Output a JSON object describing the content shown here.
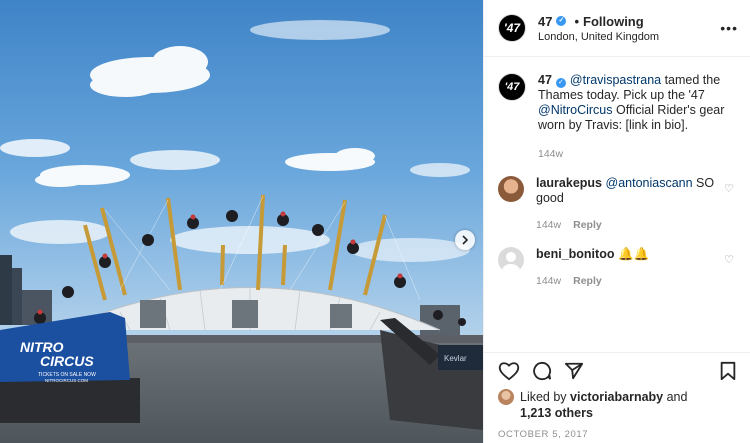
{
  "post_header": {
    "account": "47",
    "separator": "•",
    "following": "Following",
    "location": "London, United Kingdom",
    "logo_text": "'47",
    "more": "•••"
  },
  "media_caption": {
    "banner_brand_line1": "NITRO",
    "banner_brand_line2": "CIRCUS",
    "banner_tickets": "TICKETS ON SALE NOW",
    "banner_url": "NITROCIRCUS.COM",
    "boat_label": "Kevlar"
  },
  "caption": {
    "username": "47",
    "mention1": "@travispastrana",
    "text1": " tamed the Thames today. Pick up the '47 ",
    "mention2": "@NitroCircus",
    "text2": " Official Rider's gear worn by Travis: [link in bio].",
    "time": "144w"
  },
  "comments": [
    {
      "username": "laurakepus",
      "mention": "@antoniascann",
      "text": " SO good",
      "time": "144w",
      "reply": "Reply"
    },
    {
      "username": "beni_bonitoo",
      "mention": "",
      "text": " 🔔🔔",
      "time": "144w",
      "reply": "Reply"
    }
  ],
  "likes": {
    "prefix": "Liked by ",
    "user": "victoriabarnaby",
    "mid": " and",
    "count": "1,213 others"
  },
  "date": "OCTOBER 5, 2017",
  "colors": {
    "link": "#00376b",
    "verified": "#3897f0",
    "muted": "#8e8e8e"
  }
}
